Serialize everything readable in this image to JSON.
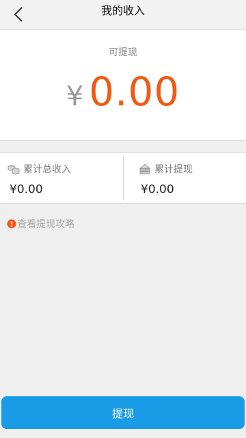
{
  "header": {
    "title": "我的收入"
  },
  "balance": {
    "label": "可提现",
    "currency": "¥",
    "amount": "0.00"
  },
  "stats": {
    "total_income": {
      "label": "累计总收入",
      "value": "¥0.00",
      "icon": "coins-icon"
    },
    "total_withdrawn": {
      "label": "累计提现",
      "value": "¥0.00",
      "icon": "withdraw-icon"
    }
  },
  "guide": {
    "text": "查看提现攻略",
    "icon": "info-icon"
  },
  "footer": {
    "withdraw_label": "提现"
  },
  "colors": {
    "accent_orange": "#f15a14",
    "button_blue": "#1a9be6",
    "background": "#efefef"
  }
}
